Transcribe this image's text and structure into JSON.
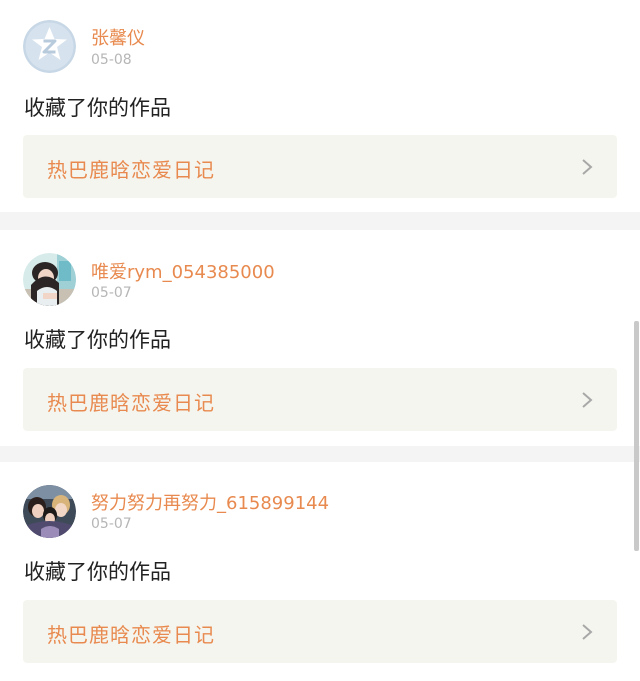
{
  "notifications": [
    {
      "username": "张馨仪",
      "date": "05-08",
      "action": "收藏了你的作品",
      "work_title": "热巴鹿晗恋爱日记",
      "avatar": "qq-default-avatar"
    },
    {
      "username": "唯爱rym_054385000",
      "date": "05-07",
      "action": "收藏了你的作品",
      "work_title": "热巴鹿晗恋爱日记",
      "avatar": "girl-photo-avatar"
    },
    {
      "username": "努力努力再努力_615899144",
      "date": "05-07",
      "action": "收藏了你的作品",
      "work_title": "热巴鹿晗恋爱日记",
      "avatar": "group-photo-avatar"
    }
  ],
  "icons": {
    "chevron": "chevron-right-icon"
  },
  "colors": {
    "accent": "#e88a4f",
    "date_gray": "#b6b6b6",
    "link_bg": "#f5f5ef",
    "page_bg": "#f4f4f4"
  }
}
